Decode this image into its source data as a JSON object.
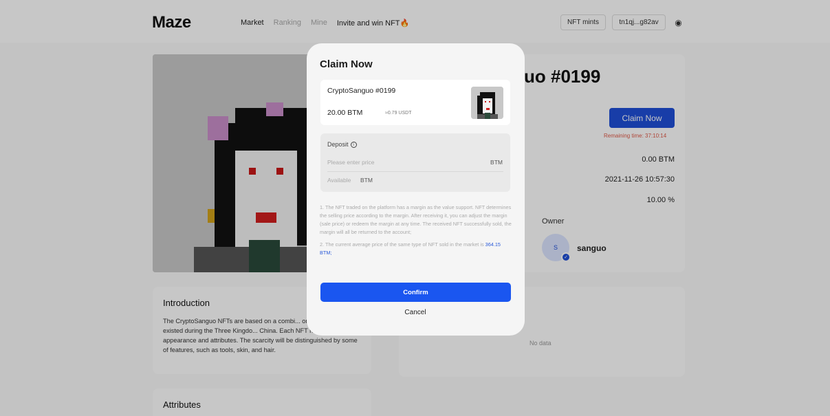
{
  "header": {
    "logo": "Maze",
    "nav": [
      "Market",
      "Ranking",
      "Mine",
      "Invite and win NFT🔥"
    ],
    "nft_mints_label": "NFT mints",
    "wallet_label": "tn1qj...g82av"
  },
  "detail": {
    "title_partial": "uo #0199",
    "claim_button": "Claim Now",
    "remaining_time": "Remaining time:  37:10:14",
    "value_1": "0.00 BTM",
    "value_2": "2021-11-26 10:57:30",
    "value_3": "10.00 %",
    "owner_label": "Owner",
    "owner_initial": "S",
    "owner_name": "sanguo"
  },
  "introduction": {
    "title": "Introduction",
    "text": "The CryptoSanguo NFTs are based on a combi... ordinary heroes existed during the Three Kingdo... China. Each NFT has a different appearance and attributes. The scarcity will be distinguished by some of features, such as tools, skin, and hair."
  },
  "history": {
    "empty_text": "No data"
  },
  "attributes": {
    "title": "Attributes"
  },
  "modal": {
    "title": "Claim Now",
    "item_name": "CryptoSanguo #0199",
    "item_price": "20.00 BTM",
    "item_usdt": "≈0.79 USDT",
    "deposit_label": "Deposit",
    "price_placeholder": "Please enter price",
    "price_unit": "BTM",
    "available_label": "Available",
    "available_unit": "BTM",
    "note_1": "1. The NFT traded on the platform has a margin as the value support. NFT determines the selling price according to the margin. After receiving it, you can adjust the margin (sale price) or redeem the margin at any time. The received NFT successfully sold, the margin will all be returned to the account;",
    "note_2_prefix": "2. The current average price of the same type of NFT sold in the market is ",
    "note_2_value": "364.15 BTM;",
    "confirm_label": "Confirm",
    "cancel_label": "Cancel"
  },
  "colors": {
    "primary": "#1a56f0",
    "accent_dark": "#1f4fd8",
    "warning": "#e05a48"
  }
}
